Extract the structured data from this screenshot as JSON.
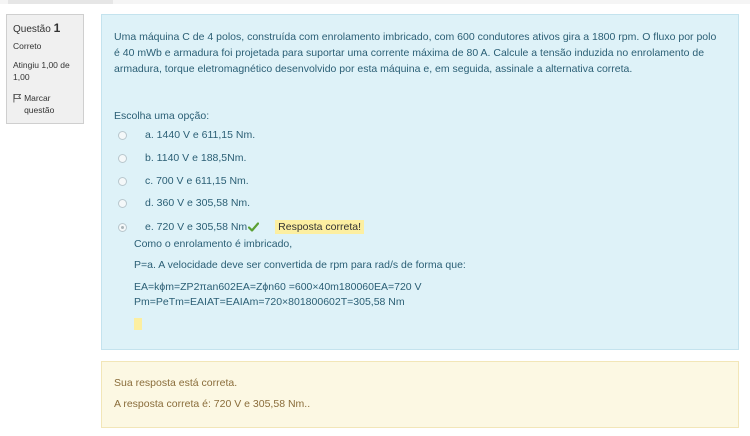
{
  "info": {
    "question_word": "Questão",
    "question_number": "1",
    "state": "Correto",
    "grade": "Atingiu 1,00 de 1,00",
    "flag_label": "Marcar questão"
  },
  "question": {
    "text": "Uma máquina C de 4 polos, construída com enrolamento imbricado, com 600 condutores ativos gira a 1800 rpm. O fluxo por polo é 40 mWb e armadura foi projetada para suportar uma corrente máxima de 80 A. Calcule a tensão induzida no enrolamento de armadura, torque eletromagnético desenvolvido por esta máquina e, em seguida, assinale a alternativa correta.",
    "prompt": "Escolha uma opção:",
    "options": [
      {
        "label": "a. 1440 V e 611,15 Nm."
      },
      {
        "label": "b. 1140 V e 188,5Nm."
      },
      {
        "label": "c. 700 V e 611,15 Nm."
      },
      {
        "label": "d. 360 V e 305,58 Nm."
      },
      {
        "label": "e. 720 V e 305,58 Nm"
      }
    ],
    "selected_index": 4,
    "feedback": "Resposta correta!",
    "explanation": [
      "Como o enrolamento é imbricado,",
      "P=a. A velocidade deve ser convertida de rpm para rad/s de forma que:",
      "EA=kϕm=ZP2πan602EA=Zϕn60 =600×40m180060EA=720 V",
      "Pm=PeTm=EAIAT=EAIAm=720×801800602T=305,58 Nm"
    ]
  },
  "outcome": {
    "line1": "Sua resposta está correta.",
    "line2": "A resposta correta é: 720 V e 305,58 Nm.."
  },
  "icons": {
    "flag": "flag-icon",
    "check": "check-icon"
  },
  "colors": {
    "question_bg": "#def2f8",
    "outcome_bg": "#fcf8e3",
    "feedback_bg": "#fcefa1",
    "check_green": "#5ba033"
  }
}
